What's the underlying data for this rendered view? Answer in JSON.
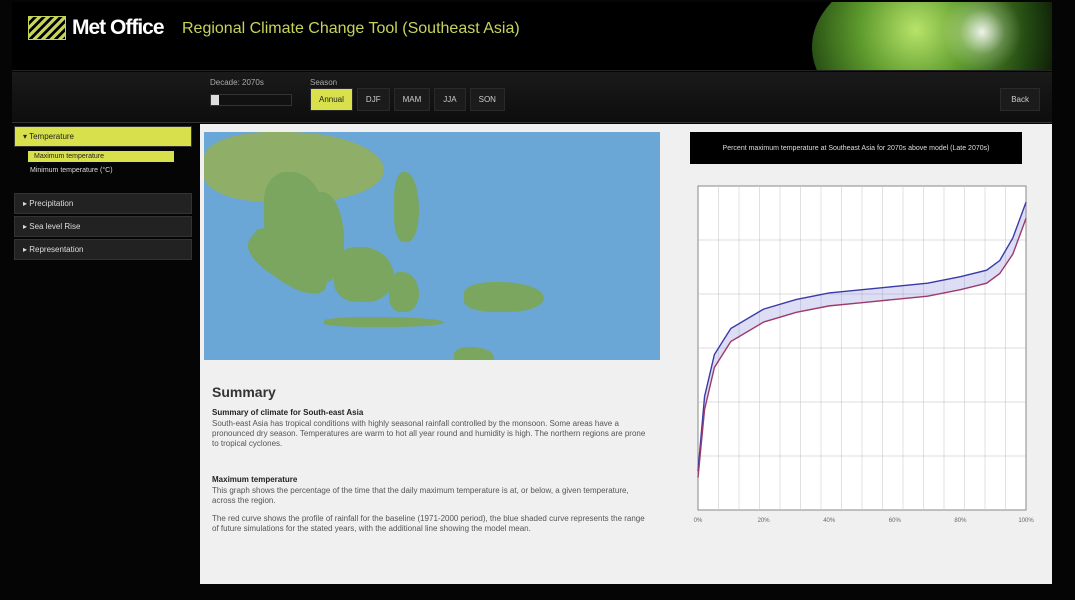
{
  "header": {
    "logo_text": "Met Office",
    "title": "Regional Climate Change Tool (Southeast Asia)"
  },
  "toolbar": {
    "decade_label": "Decade: 2070s",
    "season_label": "Season",
    "seasons": [
      "Annual",
      "DJF",
      "MAM",
      "JJA",
      "SON"
    ],
    "active_season": 0,
    "right_button": "Back"
  },
  "sidebar": {
    "sections": [
      {
        "label": "Temperature",
        "active": true
      },
      {
        "label": "Precipitation",
        "active": false
      },
      {
        "label": "Sea level Rise",
        "active": false
      },
      {
        "label": "Representation",
        "active": false
      }
    ],
    "temperature_items": [
      {
        "label": "Maximum temperature",
        "active": true
      },
      {
        "label": "Minimum temperature (°C)",
        "active": false
      }
    ]
  },
  "summary": {
    "heading": "Summary",
    "sub1": "Summary of climate for South-east Asia",
    "text1": "South-east Asia has tropical conditions with highly seasonal rainfall controlled by the monsoon. Some areas have a pronounced dry season. Temperatures are warm to hot all year round and humidity is high. The northern regions are prone to tropical cyclones.",
    "sub2": "Maximum temperature",
    "text2": "This graph shows the percentage of the time that the daily maximum temperature is at, or below, a given temperature, across the region.",
    "text3": "The red curve shows the profile of rainfall for the baseline (1971-2000 period), the blue shaded curve represents the range of future simulations for the stated years, with the additional line showing the model mean."
  },
  "chart": {
    "title": "Percent maximum temperature at Southeast Asia for 2070s above model (Late 2070s)"
  },
  "chart_data": {
    "type": "line",
    "xlim": [
      0,
      100
    ],
    "x_tick_labels": [
      "0%",
      "20%",
      "40%",
      "60%",
      "80%",
      "100%"
    ],
    "grid": true,
    "series": [
      {
        "color": "#3a3aa8",
        "x": [
          0,
          2,
          5,
          10,
          20,
          30,
          40,
          50,
          60,
          70,
          80,
          88,
          92,
          96,
          100
        ],
        "y": [
          12,
          35,
          48,
          56,
          62,
          65,
          67,
          68,
          69,
          70,
          72,
          74,
          77,
          84,
          95
        ]
      },
      {
        "color": "#9c3b6b",
        "x": [
          0,
          2,
          5,
          10,
          20,
          30,
          40,
          50,
          60,
          70,
          80,
          88,
          92,
          96,
          100
        ],
        "y": [
          10,
          31,
          44,
          52,
          58,
          61,
          63,
          64,
          65,
          66,
          68,
          70,
          73,
          79,
          90
        ]
      }
    ],
    "ylim": [
      0,
      100
    ]
  },
  "colors": {
    "accent": "#d8e04c",
    "baseline": "#9c3b6b",
    "projection": "#3a3aa8"
  }
}
